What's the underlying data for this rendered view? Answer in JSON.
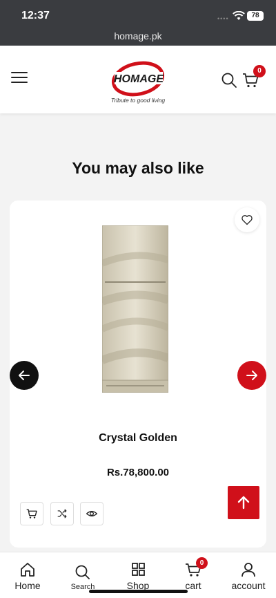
{
  "status_bar": {
    "time": "12:37",
    "url": "homage.pk",
    "battery": "78",
    "signal": "••••"
  },
  "header": {
    "logo_text": "HOMAGE",
    "tagline": "Tribute to good living",
    "cart_count": "0",
    "icons": [
      "menu-icon",
      "search-icon",
      "cart-icon"
    ]
  },
  "section": {
    "title": "You may also like"
  },
  "product": {
    "name": "Crystal Golden",
    "price": "Rs.78,800.00"
  },
  "bottom_nav": {
    "items": [
      {
        "label": "Home",
        "icon": "home-icon"
      },
      {
        "label": "Search",
        "icon": "search-icon"
      },
      {
        "label": "Shop",
        "icon": "grid-icon"
      },
      {
        "label": "cart",
        "icon": "cart-icon"
      },
      {
        "label": "account",
        "icon": "user-icon"
      }
    ],
    "cart_count": "0"
  },
  "colors": {
    "accent": "#d0101a",
    "dark": "#111111",
    "status_bar": "#3a3c40"
  }
}
